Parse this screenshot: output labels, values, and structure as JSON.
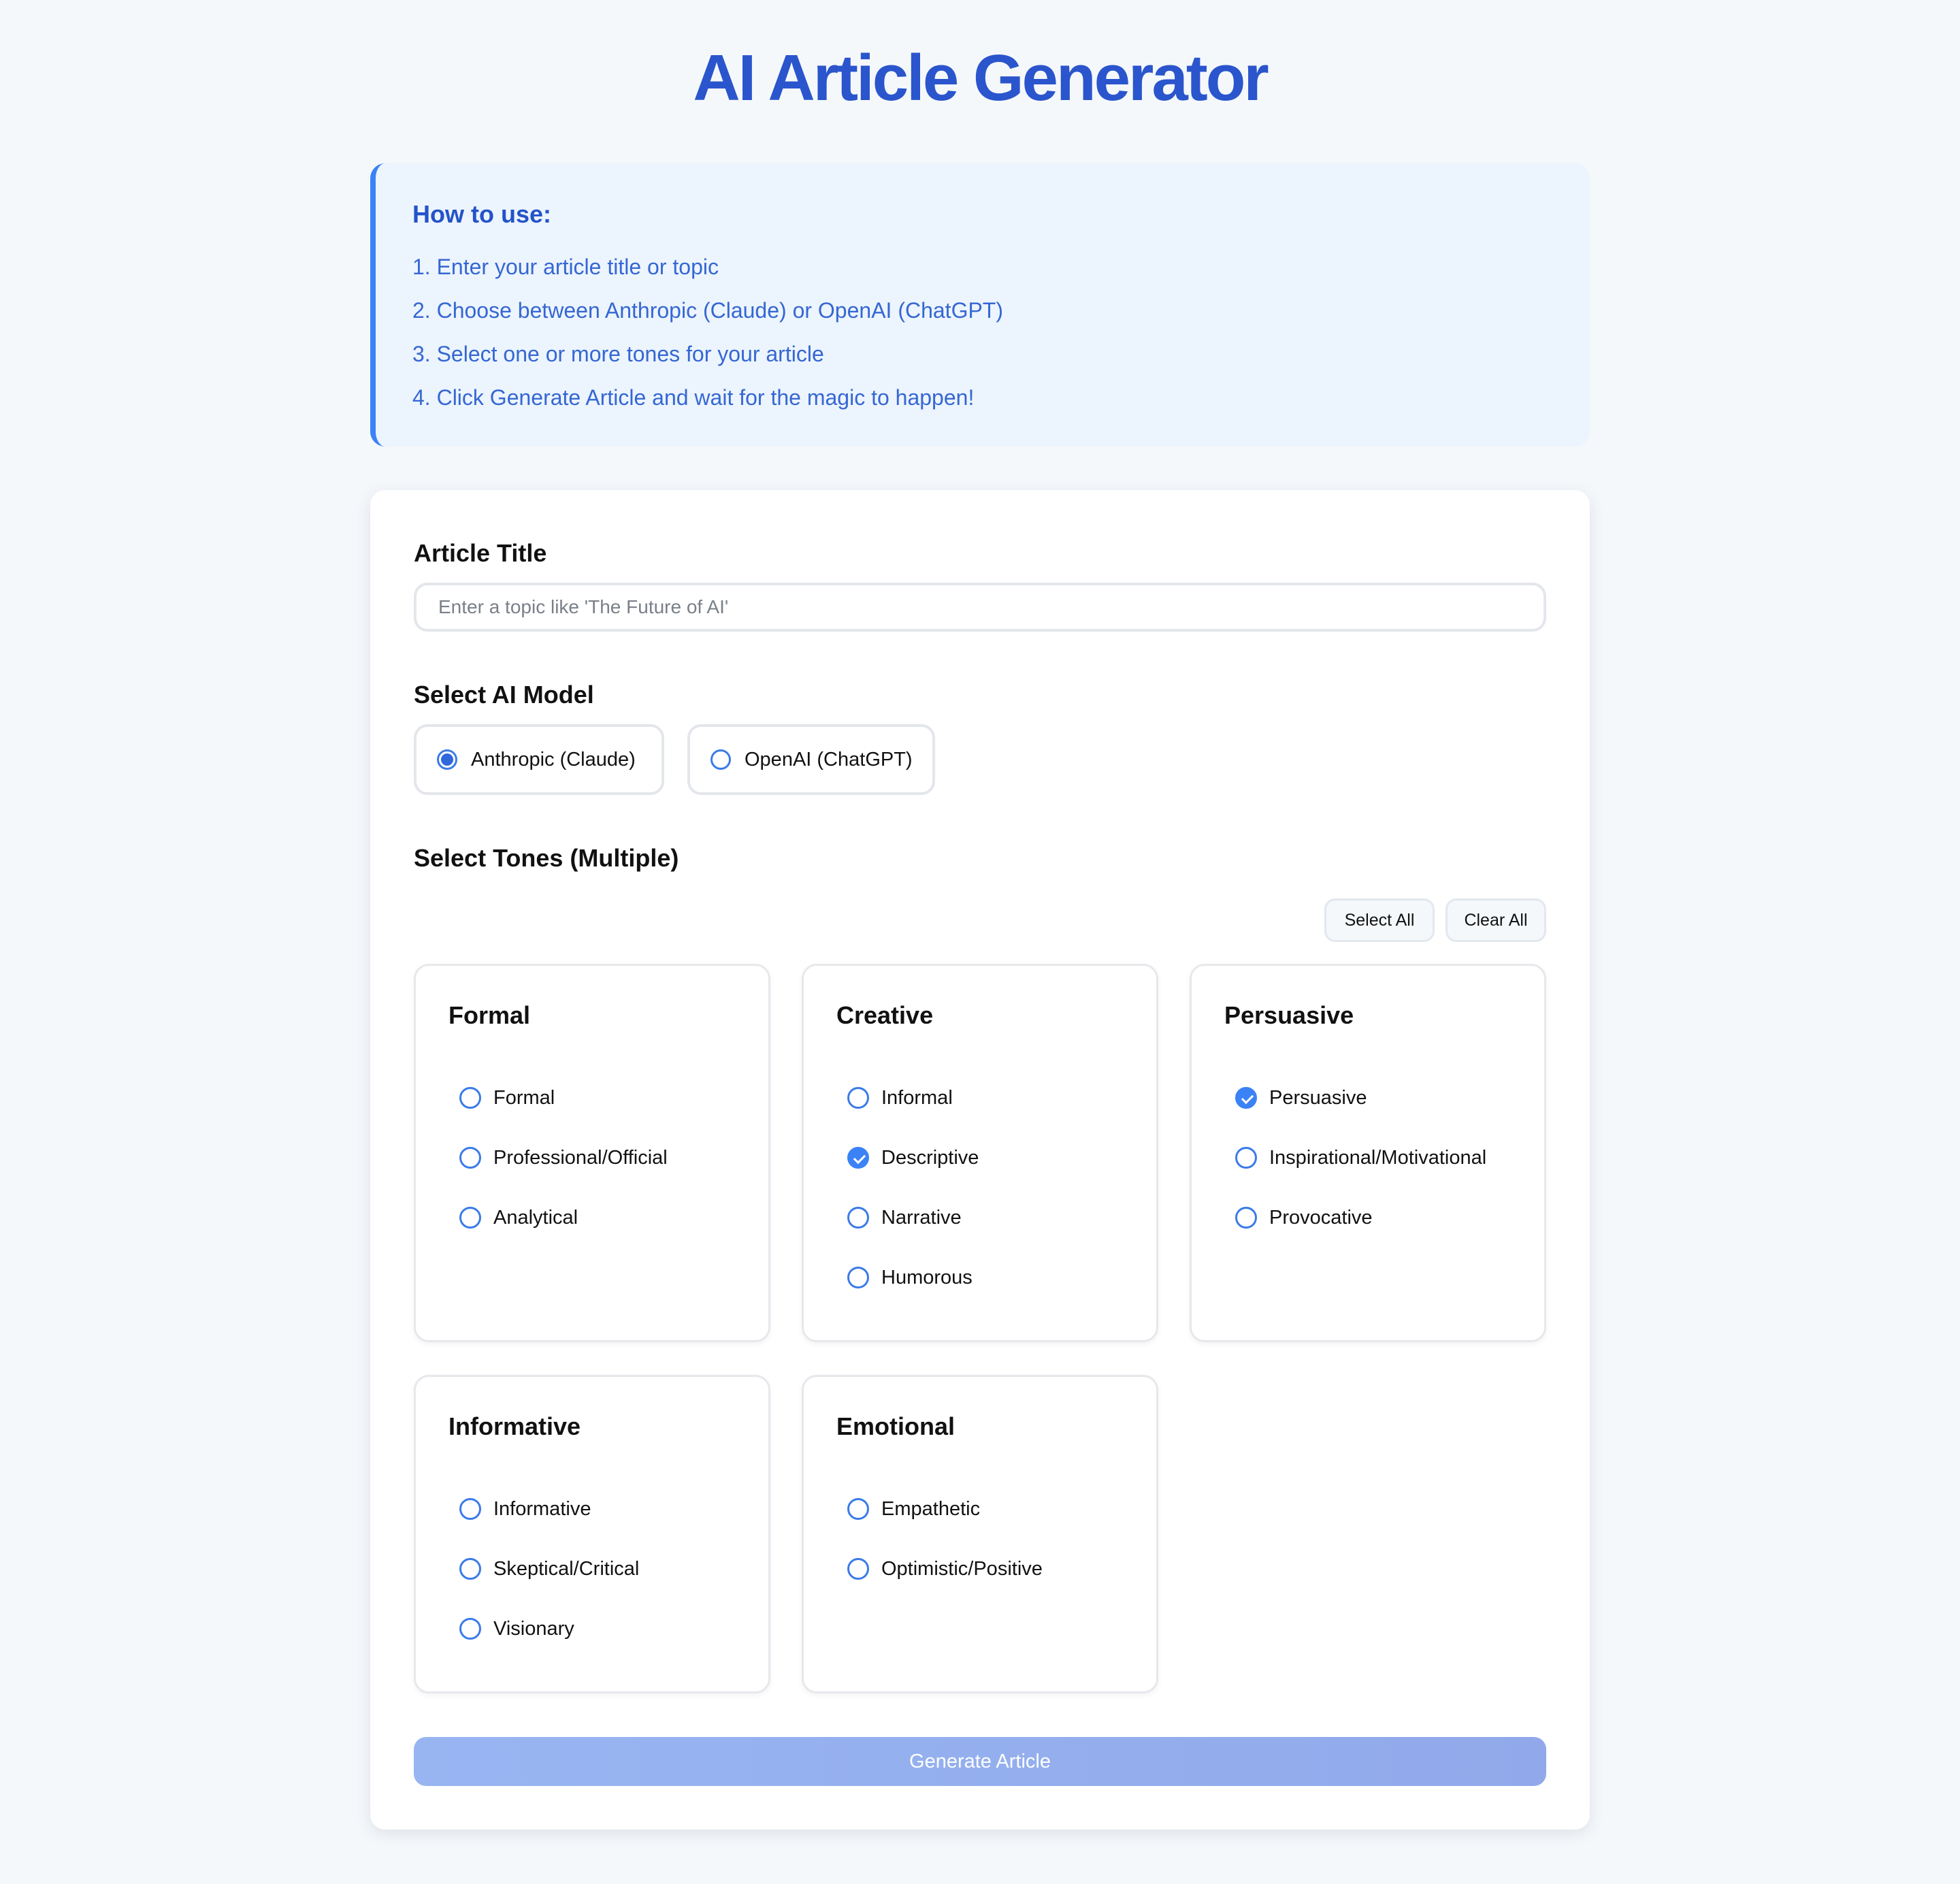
{
  "header": {
    "title": "AI Article Generator"
  },
  "instructions": {
    "heading": "How to use:",
    "steps": [
      "1. Enter your article title or topic",
      "2. Choose between Anthropic (Claude) or OpenAI (ChatGPT)",
      "3. Select one or more tones for your article",
      "4. Click Generate Article and wait for the magic to happen!"
    ]
  },
  "form": {
    "title_label": "Article Title",
    "title_value": "",
    "title_placeholder": "Enter a topic like 'The Future of AI'",
    "model_label": "Select AI Model",
    "models": [
      {
        "label": "Anthropic (Claude)",
        "selected": true
      },
      {
        "label": "OpenAI (ChatGPT)",
        "selected": false
      }
    ],
    "tones_label": "Select Tones (Multiple)",
    "select_all": "Select All",
    "clear_all": "Clear All",
    "tone_groups": [
      {
        "name": "Formal",
        "options": [
          {
            "label": "Formal",
            "checked": false
          },
          {
            "label": "Professional/Official",
            "checked": false
          },
          {
            "label": "Analytical",
            "checked": false
          }
        ]
      },
      {
        "name": "Creative",
        "options": [
          {
            "label": "Informal",
            "checked": false
          },
          {
            "label": "Descriptive",
            "checked": true
          },
          {
            "label": "Narrative",
            "checked": false
          },
          {
            "label": "Humorous",
            "checked": false
          }
        ]
      },
      {
        "name": "Persuasive",
        "options": [
          {
            "label": "Persuasive",
            "checked": true
          },
          {
            "label": "Inspirational/Motivational",
            "checked": false
          },
          {
            "label": "Provocative",
            "checked": false
          }
        ]
      },
      {
        "name": "Informative",
        "options": [
          {
            "label": "Informative",
            "checked": false
          },
          {
            "label": "Skeptical/Critical",
            "checked": false
          },
          {
            "label": "Visionary",
            "checked": false
          }
        ]
      },
      {
        "name": "Emotional",
        "options": [
          {
            "label": "Empathetic",
            "checked": false
          },
          {
            "label": "Optimistic/Positive",
            "checked": false
          }
        ]
      }
    ],
    "generate_label": "Generate Article",
    "generate_enabled": false
  },
  "colors": {
    "accent": "#2a55cc",
    "primary": "#3b82f6",
    "info_background": "#ecf4fd",
    "page_background": "#f5f8fb",
    "generate_disabled": "#94b0ef"
  }
}
